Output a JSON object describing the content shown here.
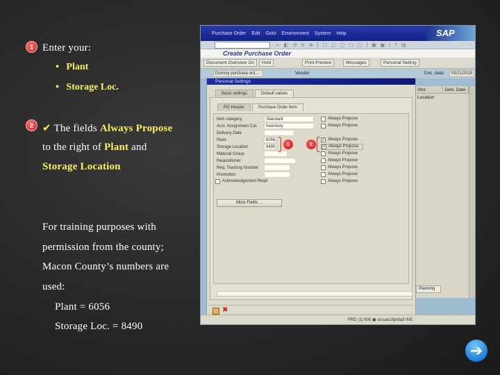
{
  "instructions": {
    "step1": {
      "badge": "1",
      "intro": "Enter your:",
      "bullets": [
        "Plant",
        "Storage Loc."
      ],
      "bullet_char": "•"
    },
    "step2": {
      "badge": "2",
      "check": "✔",
      "line1_pre": "The fields ",
      "line1_hl": "Always Propose",
      "line2_pre": "to the right of ",
      "line2_hl": "Plant",
      "line2_post": " and",
      "line3_hl": "Storage Location"
    },
    "note": {
      "lines": [
        "For training purposes with",
        "permission from the county;",
        "Macon County’s numbers are",
        "used:"
      ],
      "values": [
        "Plant = 6056",
        "Storage Loc. = 8490"
      ]
    }
  },
  "sap": {
    "logo": "SAP",
    "menu": [
      "Purchase Order",
      "Edit",
      "Goto",
      "Environment",
      "System",
      "Help"
    ],
    "toolbar_icons": "✓ ◧ ⟲ ⊘ ⊗ | ▢ ▢ ▢ ▢ ▢ | ▣ ▣ | ? ▤",
    "title": "Create Purchase Order",
    "app_buttons": [
      "Document Overview On",
      "Hold",
      "Print Preview",
      "Messages",
      "Personal Setting"
    ],
    "header": {
      "doc_type": "Dummy purchase ord...",
      "vendor_label": "Vendor",
      "doc_date_label": "Doc. date",
      "doc_date": "09/21/2018"
    },
    "dialog": {
      "title": "Personal Settings",
      "tabs": [
        "Basic settings",
        "Default values"
      ],
      "active_tab": "Default values",
      "subtabs": [
        "PO Header",
        "Purchase Order Item"
      ],
      "active_subtab": "Purchase Order Item",
      "fields": [
        {
          "label": "Item category",
          "value": "Standard",
          "always_propose": false
        },
        {
          "label": "Acct. Assignment Cat.",
          "value": "Inventory",
          "always_propose": false
        },
        {
          "label": "Delivery Date",
          "value": "",
          "always_propose": null
        },
        {
          "label": "Plant",
          "value": "6056",
          "always_propose": true
        },
        {
          "label": "Storage Location",
          "value": "8490",
          "always_propose": true
        },
        {
          "label": "Material Group",
          "value": "",
          "always_propose": false
        },
        {
          "label": "Requisitioner",
          "value": "",
          "always_propose": false
        },
        {
          "label": "Req. Tracking Number",
          "value": "",
          "always_propose": false
        },
        {
          "label": "Promotion",
          "value": "",
          "always_propose": false
        }
      ],
      "always_propose_label": "Always Propose",
      "ack_required_label": "Acknowledgement Reqd",
      "more_fields": "More Fields ...",
      "annotations": [
        "1",
        "2"
      ]
    },
    "table": {
      "columns": [
        "Stor. Location",
        "Delv. Date"
      ]
    },
    "planning_button": "Planning",
    "status_bar": "PRD (1) 600  ▣  sicsaa10prda3  INS"
  },
  "nav": {
    "next_icon": "➔"
  }
}
